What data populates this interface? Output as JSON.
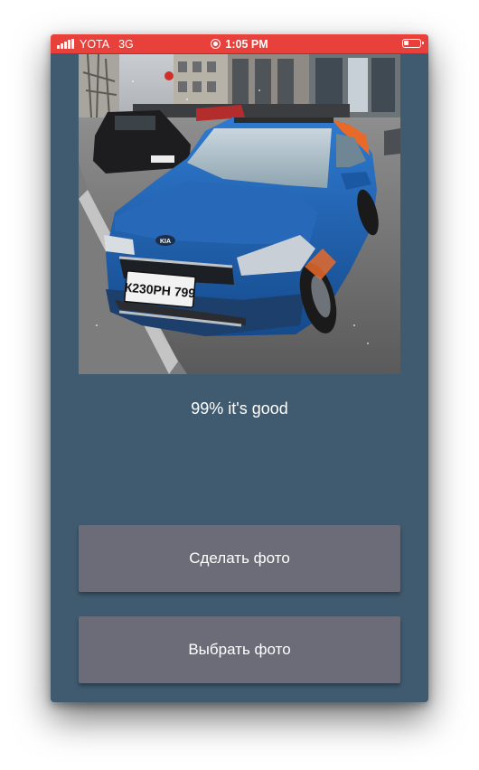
{
  "status_bar": {
    "carrier": "YOTA",
    "network": "3G",
    "time": "1:05 PM",
    "signal_icon": "signal-bars-icon",
    "record_icon": "screen-record-icon",
    "battery_icon": "battery-low-icon",
    "background_color": "#e8403a"
  },
  "photo": {
    "license_plate": "К230РН 799",
    "brand_badge": "KIA",
    "car_color": "#1f5fa8"
  },
  "result": {
    "text": "99% it's good"
  },
  "buttons": {
    "take_photo": "Сделать фото",
    "choose_photo": "Выбрать фото"
  },
  "theme": {
    "background": "#405b70",
    "button": "#6c6c78"
  }
}
